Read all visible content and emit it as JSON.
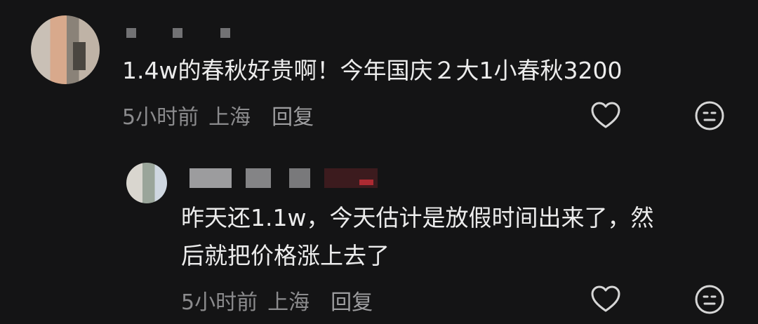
{
  "comment": {
    "text": "1.4w的春秋好贵啊！今年国庆２大1小春秋3200",
    "time": "5小时前",
    "location": "上海",
    "reply_label": "回复"
  },
  "reply": {
    "text_line1": "昨天还1.1w，今天估计是放假时间出来了，然",
    "text_line2": "后就把价格涨上去了",
    "time": "5小时前",
    "location": "上海",
    "reply_label": "回复"
  },
  "icons": {
    "like": "heart-outline-icon",
    "emoji": "neutral-face-icon"
  }
}
